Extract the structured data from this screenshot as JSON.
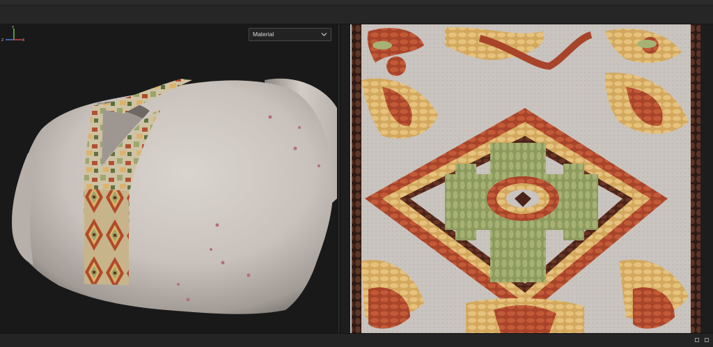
{
  "viewport_3d": {
    "channel_dropdown": {
      "selected": "Material"
    },
    "axis_gizmo": {
      "x": "X",
      "y": "Y",
      "z": "Z"
    }
  },
  "viewport_2d": {},
  "colors": {
    "panel_bg": "#1b1b1b",
    "fabric": "#cfc8c2",
    "embroidery_red": "#b04a2a",
    "embroidery_green": "#9aa56a",
    "embroidery_yellow": "#dcb26a",
    "embroidery_brown": "#5a2e1e"
  }
}
